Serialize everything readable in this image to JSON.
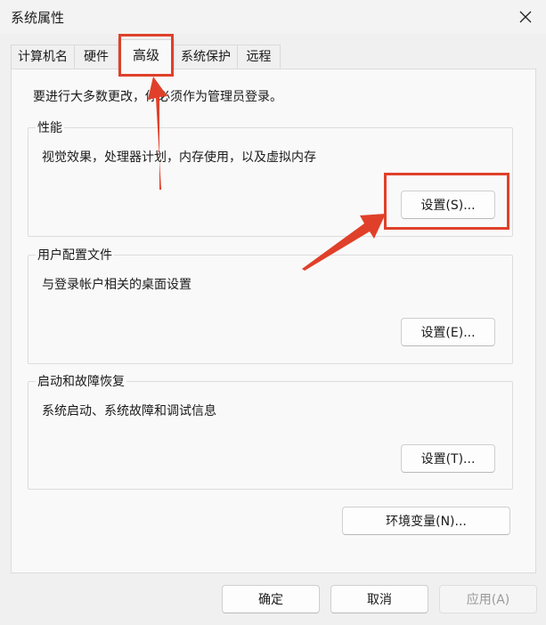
{
  "window": {
    "title": "系统属性"
  },
  "tabs": [
    {
      "label": "计算机名"
    },
    {
      "label": "硬件"
    },
    {
      "label": "高级"
    },
    {
      "label": "系统保护"
    },
    {
      "label": "远程"
    }
  ],
  "notice": "要进行大多数更改，你必须作为管理员登录。",
  "groups": {
    "performance": {
      "title": "性能",
      "desc": "视觉效果，处理器计划，内存使用，以及虚拟内存",
      "button": "设置(S)..."
    },
    "profiles": {
      "title": "用户配置文件",
      "desc": "与登录帐户相关的桌面设置",
      "button": "设置(E)..."
    },
    "startup": {
      "title": "启动和故障恢复",
      "desc": "系统启动、系统故障和调试信息",
      "button": "设置(T)..."
    }
  },
  "env_button": "环境变量(N)...",
  "footer": {
    "ok": "确定",
    "cancel": "取消",
    "apply": "应用(A)"
  },
  "annotation_color": "#e0402a",
  "icons": {
    "close": "close-icon"
  }
}
